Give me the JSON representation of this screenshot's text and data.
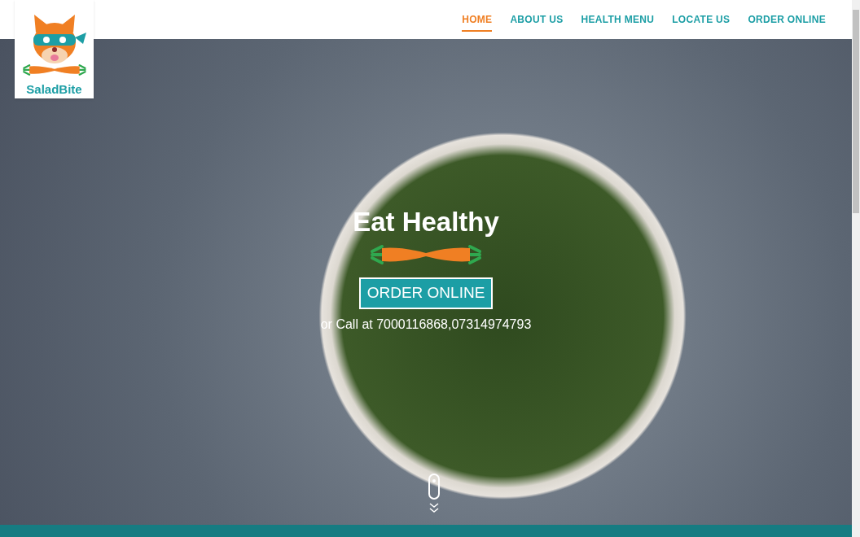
{
  "logo": {
    "text": "SaladBite"
  },
  "nav": [
    {
      "label": "HOME",
      "selected": true
    },
    {
      "label": "ABOUT US",
      "selected": false
    },
    {
      "label": "HEALTH MENU",
      "selected": false
    },
    {
      "label": "LOCATE US",
      "selected": false
    },
    {
      "label": "ORDER ONLINE",
      "selected": false
    }
  ],
  "hero": {
    "title": "Eat Healthy",
    "button": "ORDER ONLINE",
    "call_text": "or Call at 7000116868,07314974793"
  }
}
